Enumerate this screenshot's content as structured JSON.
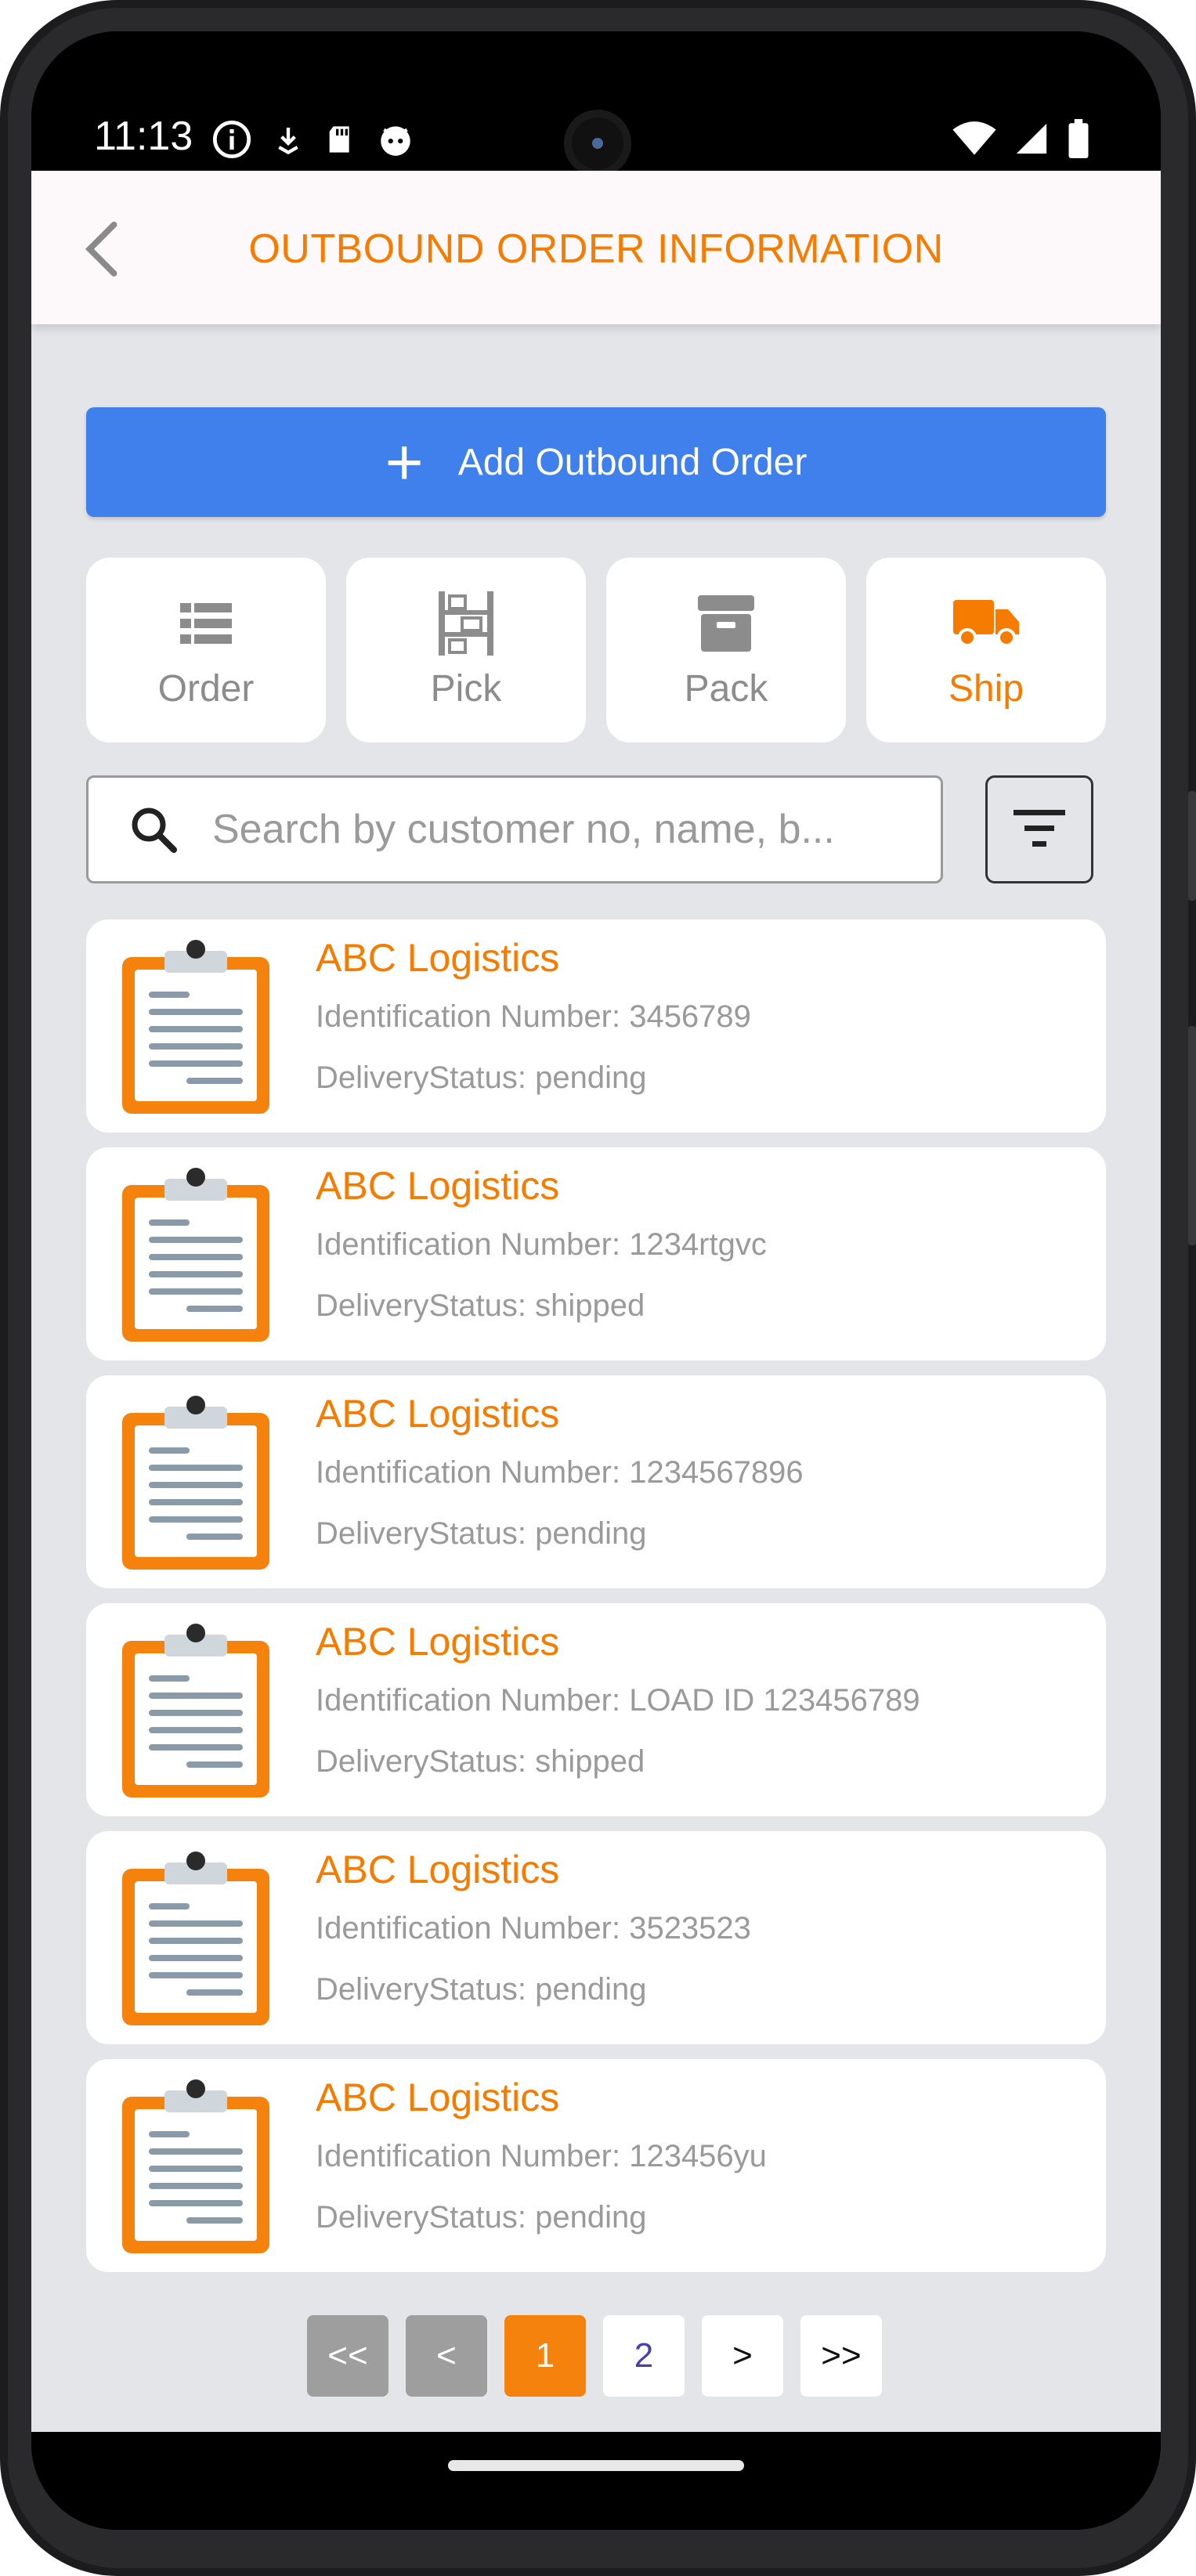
{
  "status_bar": {
    "time": "11:13"
  },
  "header": {
    "title": "OUTBOUND ORDER INFORMATION"
  },
  "actions": {
    "add_label": "Add Outbound Order"
  },
  "tabs": [
    {
      "label": "Order",
      "icon": "list-icon",
      "active": false
    },
    {
      "label": "Pick",
      "icon": "shelf-icon",
      "active": false
    },
    {
      "label": "Pack",
      "icon": "archive-box-icon",
      "active": false
    },
    {
      "label": "Ship",
      "icon": "truck-icon",
      "active": true
    }
  ],
  "search": {
    "placeholder": "Search by customer no, name, b..."
  },
  "orders": [
    {
      "name": "ABC Logistics",
      "id_line": "Identification Number: 3456789",
      "status_line": "DeliveryStatus: pending"
    },
    {
      "name": "ABC Logistics",
      "id_line": "Identification Number: 1234rtgvc",
      "status_line": "DeliveryStatus: shipped"
    },
    {
      "name": "ABC Logistics",
      "id_line": "Identification Number: 1234567896",
      "status_line": "DeliveryStatus: pending"
    },
    {
      "name": "ABC Logistics",
      "id_line": "Identification Number: LOAD ID 123456789",
      "status_line": "DeliveryStatus: shipped"
    },
    {
      "name": "ABC Logistics",
      "id_line": "Identification Number: 3523523",
      "status_line": "DeliveryStatus: pending"
    },
    {
      "name": "ABC Logistics",
      "id_line": "Identification Number: 123456yu",
      "status_line": "DeliveryStatus: pending"
    }
  ],
  "pagination": {
    "first": "<<",
    "prev": "<",
    "pages": [
      "1",
      "2"
    ],
    "current": "1",
    "next": ">",
    "last": ">>"
  },
  "colors": {
    "accent": "#f57c00",
    "primary_button": "#4080ed",
    "background": "#e4e5e9"
  }
}
